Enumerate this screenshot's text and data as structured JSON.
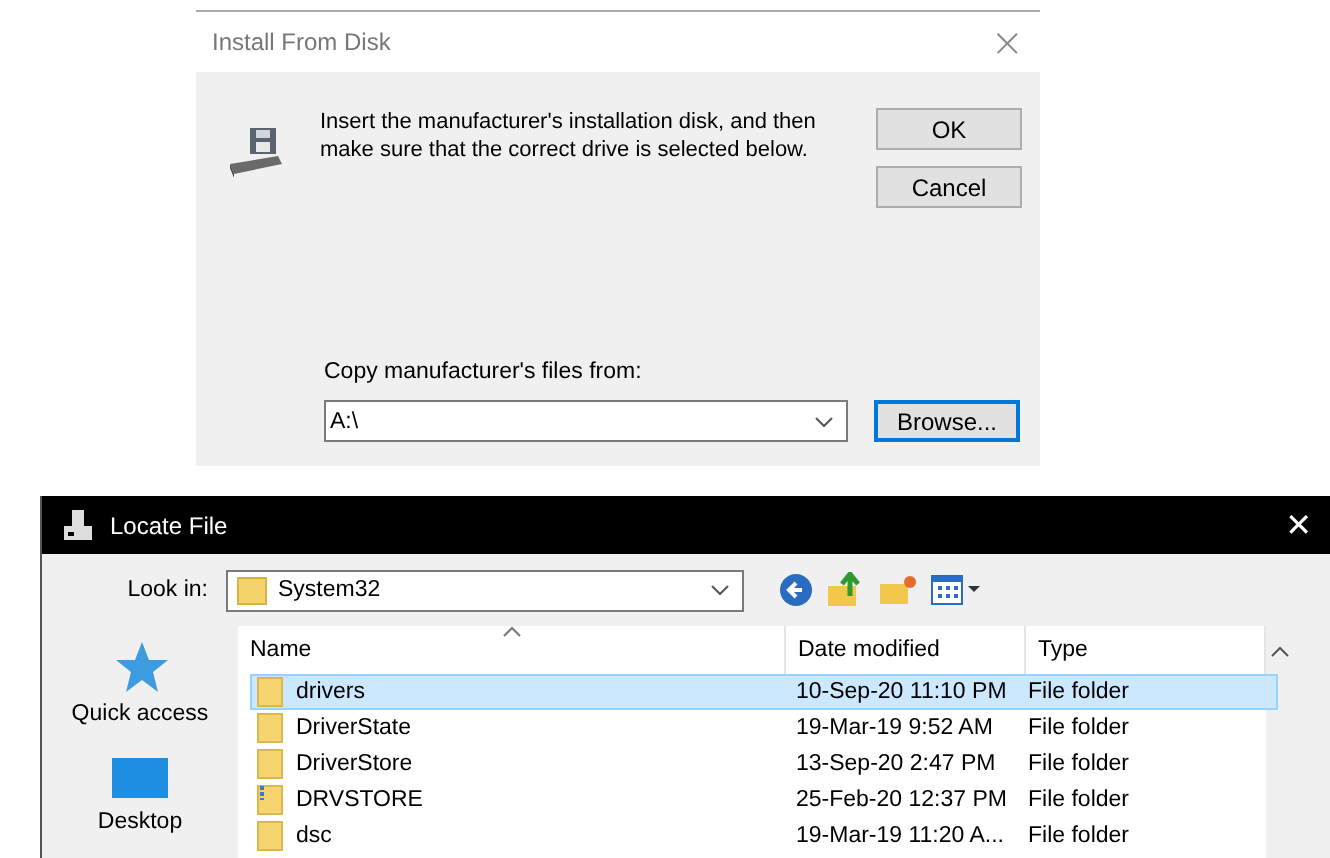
{
  "install_dialog": {
    "title": "Install From Disk",
    "close": "×",
    "message": "Insert the manufacturer's installation disk, and then make sure that the correct drive is selected below.",
    "buttons": [
      {
        "label": "OK",
        "focused": false
      },
      {
        "label": "Cancel",
        "focused": false
      }
    ],
    "copy_label": "Copy manufacturer's files from:",
    "copy_value": "A:\\",
    "browse": {
      "label": "Browse...",
      "focused": true
    }
  },
  "locate_dialog": {
    "title": "Locate File",
    "close": "✕",
    "look_in_label": "Look in:",
    "look_in_value": "System32",
    "places": [
      {
        "label": "Quick access",
        "kind": "star"
      },
      {
        "label": "Desktop",
        "kind": "desktop"
      }
    ],
    "columns": [
      "Name",
      "Date modified",
      "Type"
    ],
    "rows": [
      {
        "name": "drivers",
        "date": "10-Sep-20 11:10 PM",
        "type": "File folder",
        "kind": "folder",
        "selected": true
      },
      {
        "name": "DriverState",
        "date": "19-Mar-19 9:52 AM",
        "type": "File folder",
        "kind": "folder",
        "selected": false
      },
      {
        "name": "DriverStore",
        "date": "13-Sep-20 2:47 PM",
        "type": "File folder",
        "kind": "folder",
        "selected": false
      },
      {
        "name": "DRVSTORE",
        "date": "25-Feb-20 12:37 PM",
        "type": "File folder",
        "kind": "zipfolder",
        "selected": false
      },
      {
        "name": "dsc",
        "date": "19-Mar-19 11:20 A...",
        "type": "File folder",
        "kind": "folder",
        "selected": false
      }
    ]
  }
}
